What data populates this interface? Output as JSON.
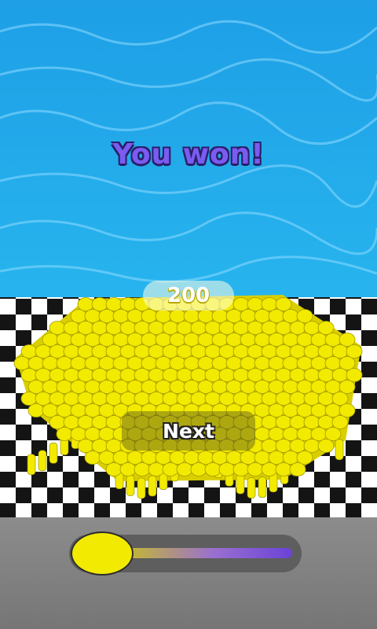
{
  "hud": {
    "title": "You won!",
    "crowd_count": "200",
    "next_label": "Next"
  },
  "slider": {
    "progress": 0.0
  },
  "colors": {
    "water": "#22a9ea",
    "crowd": "#f2ea00",
    "title": "#7a5cf0",
    "panel": "#808080"
  }
}
